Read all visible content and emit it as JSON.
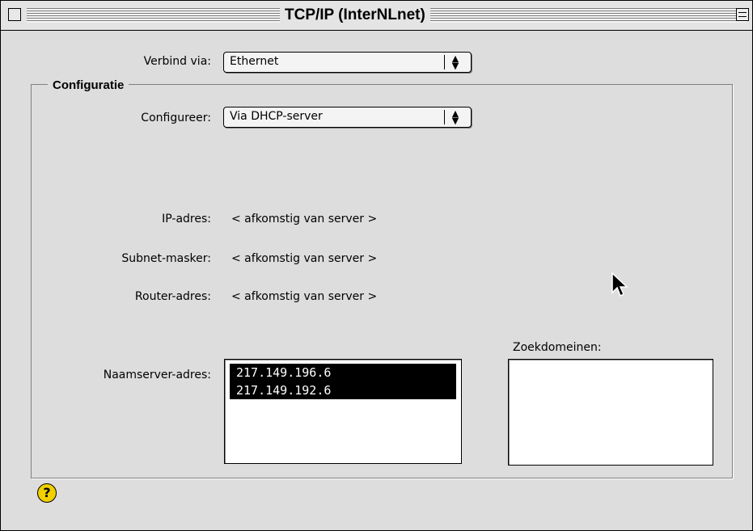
{
  "window": {
    "title": "TCP/IP (InterNLnet)"
  },
  "connect": {
    "label": "Verbind via:",
    "value": "Ethernet"
  },
  "config": {
    "group_title": "Configuratie",
    "configure_label": "Configureer:",
    "configure_value": "Via DHCP-server",
    "ip_label": "IP-adres:",
    "ip_value": "< afkomstig van server >",
    "subnet_label": "Subnet-masker:",
    "subnet_value": "< afkomstig van server >",
    "router_label": "Router-adres:",
    "router_value": "< afkomstig van server >",
    "nameserver_label": "Naamserver-adres:",
    "nameservers": [
      "217.149.196.6",
      "217.149.192.6"
    ],
    "searchdomains_label": "Zoekdomeinen:"
  },
  "help": {
    "glyph": "?"
  },
  "icons": {
    "close": "close-box-icon",
    "zoom": "zoom-box-icon",
    "help": "help-icon",
    "cursor": "mouse-pointer-icon"
  }
}
